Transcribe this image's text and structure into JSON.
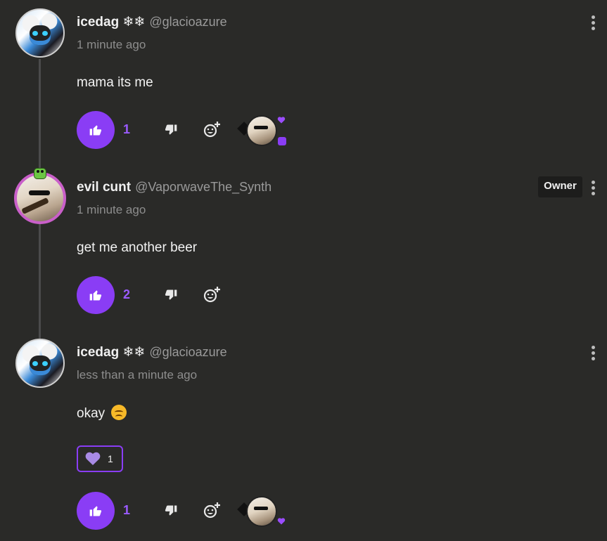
{
  "comments": [
    {
      "author_name": "icedag ❄❄",
      "author_handle": "@glacioazure",
      "timestamp": "1 minute ago",
      "text": "mama its me",
      "likes": "1",
      "badge": "",
      "reactors": [
        "heart",
        "chat"
      ]
    },
    {
      "author_name": "evil cunt",
      "author_handle": "@VaporwaveThe_Synth",
      "timestamp": "1 minute ago",
      "text": "get me another beer",
      "likes": "2",
      "badge": "Owner"
    },
    {
      "author_name": "icedag ❄❄",
      "author_handle": "@glacioazure",
      "timestamp": "less than a minute ago",
      "text": "okay",
      "likes": "1",
      "reaction_chip": {
        "emoji": "purple-heart",
        "count": "1"
      },
      "reactors": [
        "heart"
      ]
    }
  ],
  "colors": {
    "background": "#2a2a28",
    "accent": "#8a3df5",
    "muted_text": "#8d8d8d",
    "thread_line": "#4b4b4b"
  },
  "icons": [
    "thumbs-up-icon",
    "thumbs-down-icon",
    "add-reaction-icon",
    "kebab-menu-icon",
    "heart-icon",
    "chat-icon",
    "sad-face-emoji"
  ]
}
